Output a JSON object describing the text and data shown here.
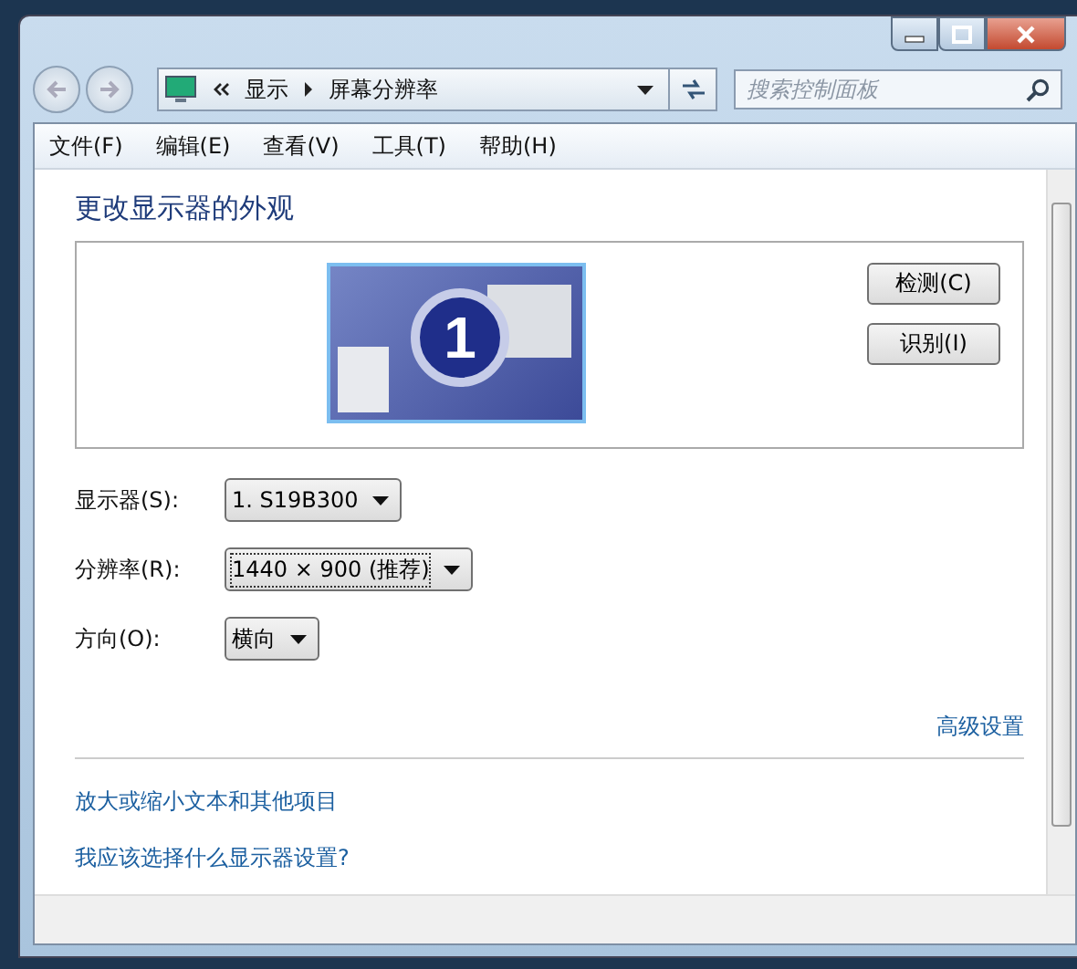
{
  "address_bar": {
    "breadcrumbs": [
      "显示",
      "屏幕分辨率"
    ]
  },
  "search": {
    "placeholder": "搜索控制面板"
  },
  "menu": [
    "文件(F)",
    "编辑(E)",
    "查看(V)",
    "工具(T)",
    "帮助(H)"
  ],
  "heading": "更改显示器的外观",
  "monitor": {
    "number": "1"
  },
  "buttons": [
    "检测(C)",
    "识别(I)"
  ],
  "settings": [
    {
      "label": "显示器(S):",
      "value": "1. S19B300",
      "focused": false
    },
    {
      "label": "分辨率(R):",
      "value": "1440 × 900 (推荐)",
      "focused": true
    },
    {
      "label": "方向(O):",
      "value": "横向",
      "focused": false
    }
  ],
  "advanced_link": "高级设置",
  "links": [
    "放大或缩小文本和其他项目",
    "我应该选择什么显示器设置?"
  ]
}
